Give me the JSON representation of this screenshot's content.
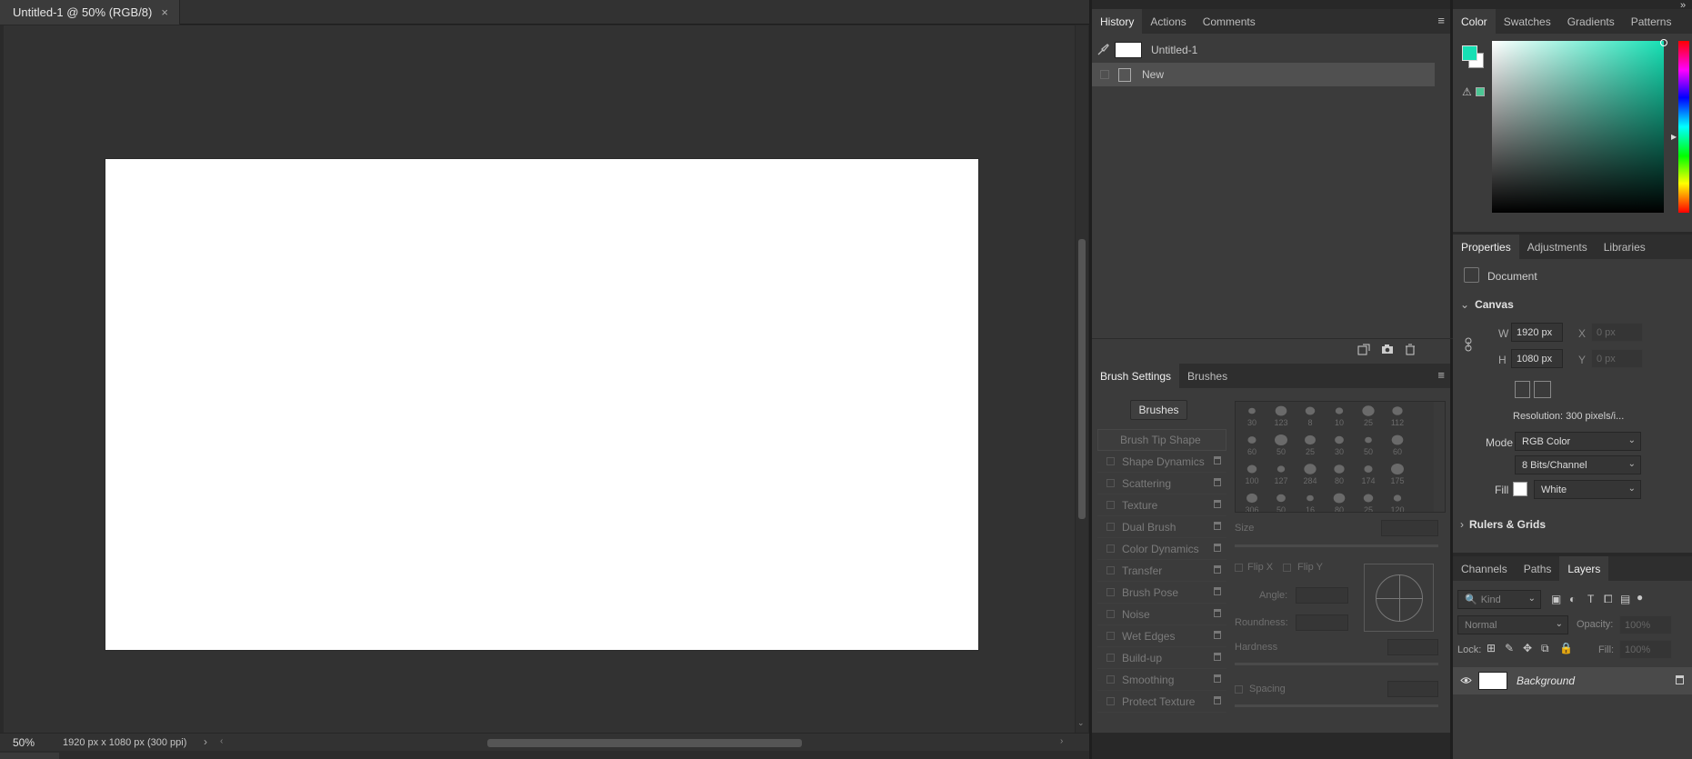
{
  "document": {
    "tab_title": "Untitled-1 @ 50% (RGB/8)",
    "tab_close": "×",
    "zoom": "50%",
    "info": "1920 px x 1080 px (300 ppi)",
    "info_arrow": "›",
    "scroll_left": "‹",
    "scroll_right": "›",
    "scroll_down": "⌄"
  },
  "collapse_icon": "»",
  "history_panel": {
    "tabs": [
      "History",
      "Actions",
      "Comments"
    ],
    "menu": "≡",
    "snapshot": "Untitled-1",
    "states": [
      "New"
    ],
    "footer_icons": [
      "new-document-from-state-icon",
      "camera-icon",
      "trash-icon"
    ]
  },
  "brush_panel": {
    "tabs": [
      "Brush Settings",
      "Brushes"
    ],
    "menu": "≡",
    "brushes_button": "Brushes",
    "tip_shape": "Brush Tip Shape",
    "options": [
      "Shape Dynamics",
      "Scattering",
      "Texture",
      "Dual Brush",
      "Color Dynamics",
      "Transfer",
      "Brush Pose",
      "Noise",
      "Wet Edges",
      "Build-up",
      "Smoothing",
      "Protect Texture"
    ],
    "tip_sizes": [
      "30",
      "123",
      "8",
      "10",
      "25",
      "112",
      "60",
      "50",
      "25",
      "30",
      "50",
      "60",
      "100",
      "127",
      "284",
      "80",
      "174",
      "175",
      "306",
      "50",
      "16",
      "80",
      "25",
      "120"
    ],
    "size_label": "Size",
    "flip_x": "Flip X",
    "flip_y": "Flip Y",
    "angle_label": "Angle:",
    "roundness_label": "Roundness:",
    "hardness_label": "Hardness",
    "spacing_label": "Spacing"
  },
  "color_panel": {
    "tabs": [
      "Color",
      "Swatches",
      "Gradients",
      "Patterns"
    ],
    "foreground": "#16e0b4",
    "background": "#ffffff",
    "gamut_warning": "⚠"
  },
  "properties_panel": {
    "tabs": [
      "Properties",
      "Adjustments",
      "Libraries"
    ],
    "doc_label": "Document",
    "canvas_section": "Canvas",
    "w_label": "W",
    "w_value": "1920 px",
    "h_label": "H",
    "h_value": "1080 px",
    "x_label": "X",
    "x_value": "0 px",
    "y_label": "Y",
    "y_value": "0 px",
    "resolution": "Resolution: 300 pixels/i...",
    "mode_label": "Mode",
    "mode_value": "RGB Color",
    "bits_value": "8 Bits/Channel",
    "fill_label": "Fill",
    "fill_value": "White",
    "rulers_section": "Rulers & Grids",
    "chevron_open": "⌄",
    "chevron_closed": "›",
    "dd_caret": "⌄"
  },
  "layers_panel": {
    "tabs": [
      "Channels",
      "Paths",
      "Layers"
    ],
    "kind": "Kind",
    "blend_mode": "Normal",
    "opacity_label": "Opacity:",
    "opacity_value": "100%",
    "lock_label": "Lock:",
    "fill_label": "Fill:",
    "fill_value": "100%",
    "layer_name": "Background",
    "eye": "👁"
  }
}
